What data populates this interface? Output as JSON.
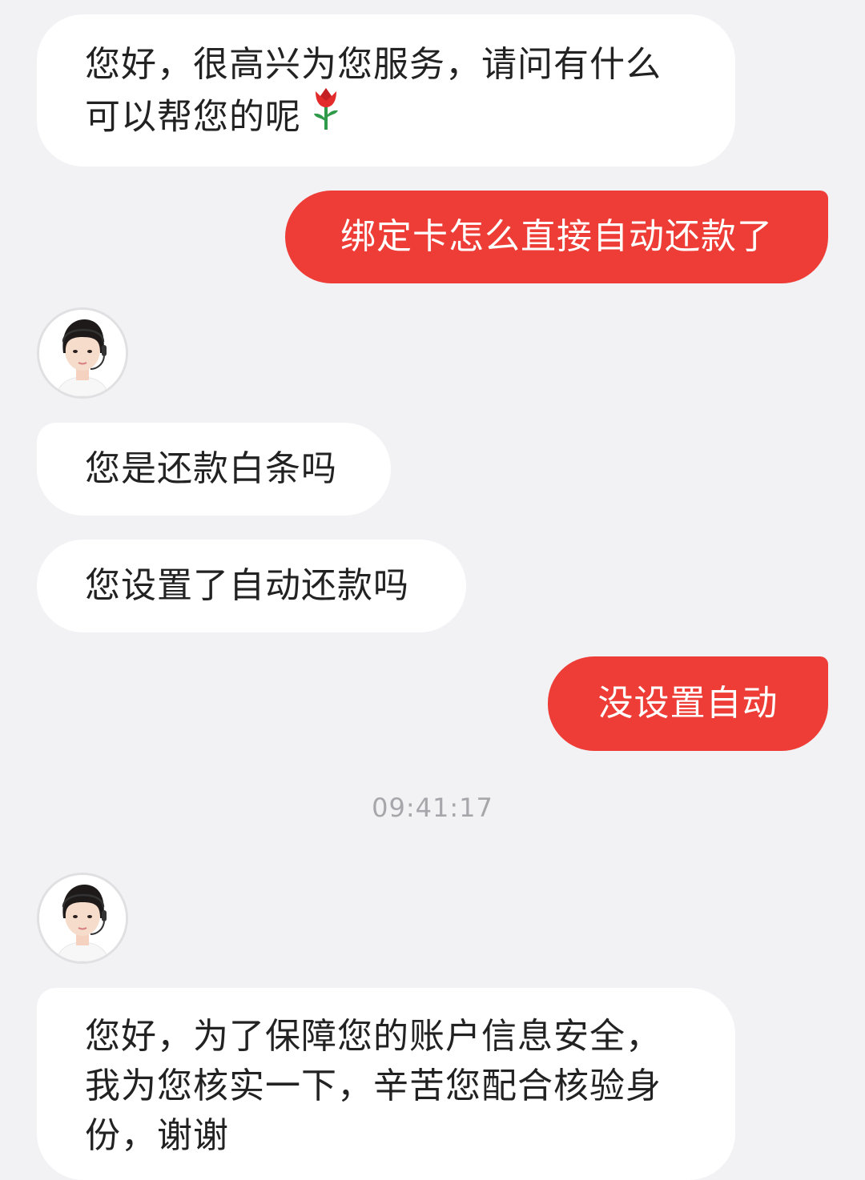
{
  "colors": {
    "background": "#f2f2f5",
    "agent_bubble": "#ffffff",
    "user_bubble": "#ee3d37",
    "timestamp": "#a6a6ab"
  },
  "messages": [
    {
      "from": "agent",
      "line1": "您好，很高兴为您服务，请问有什么",
      "line2": "可以帮您的呢",
      "icon": "rose-icon"
    },
    {
      "from": "user",
      "text": "绑定卡怎么直接自动还款了"
    },
    {
      "from": "agent",
      "text": "您是还款白条吗"
    },
    {
      "from": "agent",
      "text": "您设置了自动还款吗"
    },
    {
      "from": "user",
      "text": "没设置自动"
    },
    {
      "from": "agent",
      "line1": "您好，为了保障您的账户信息安全，",
      "line2": "我为您核实一下，辛苦您配合核验身",
      "line3": "份，谢谢"
    }
  ],
  "timestamp": "09:41:17",
  "avatars": [
    "customer-service-avatar",
    "customer-service-avatar"
  ]
}
